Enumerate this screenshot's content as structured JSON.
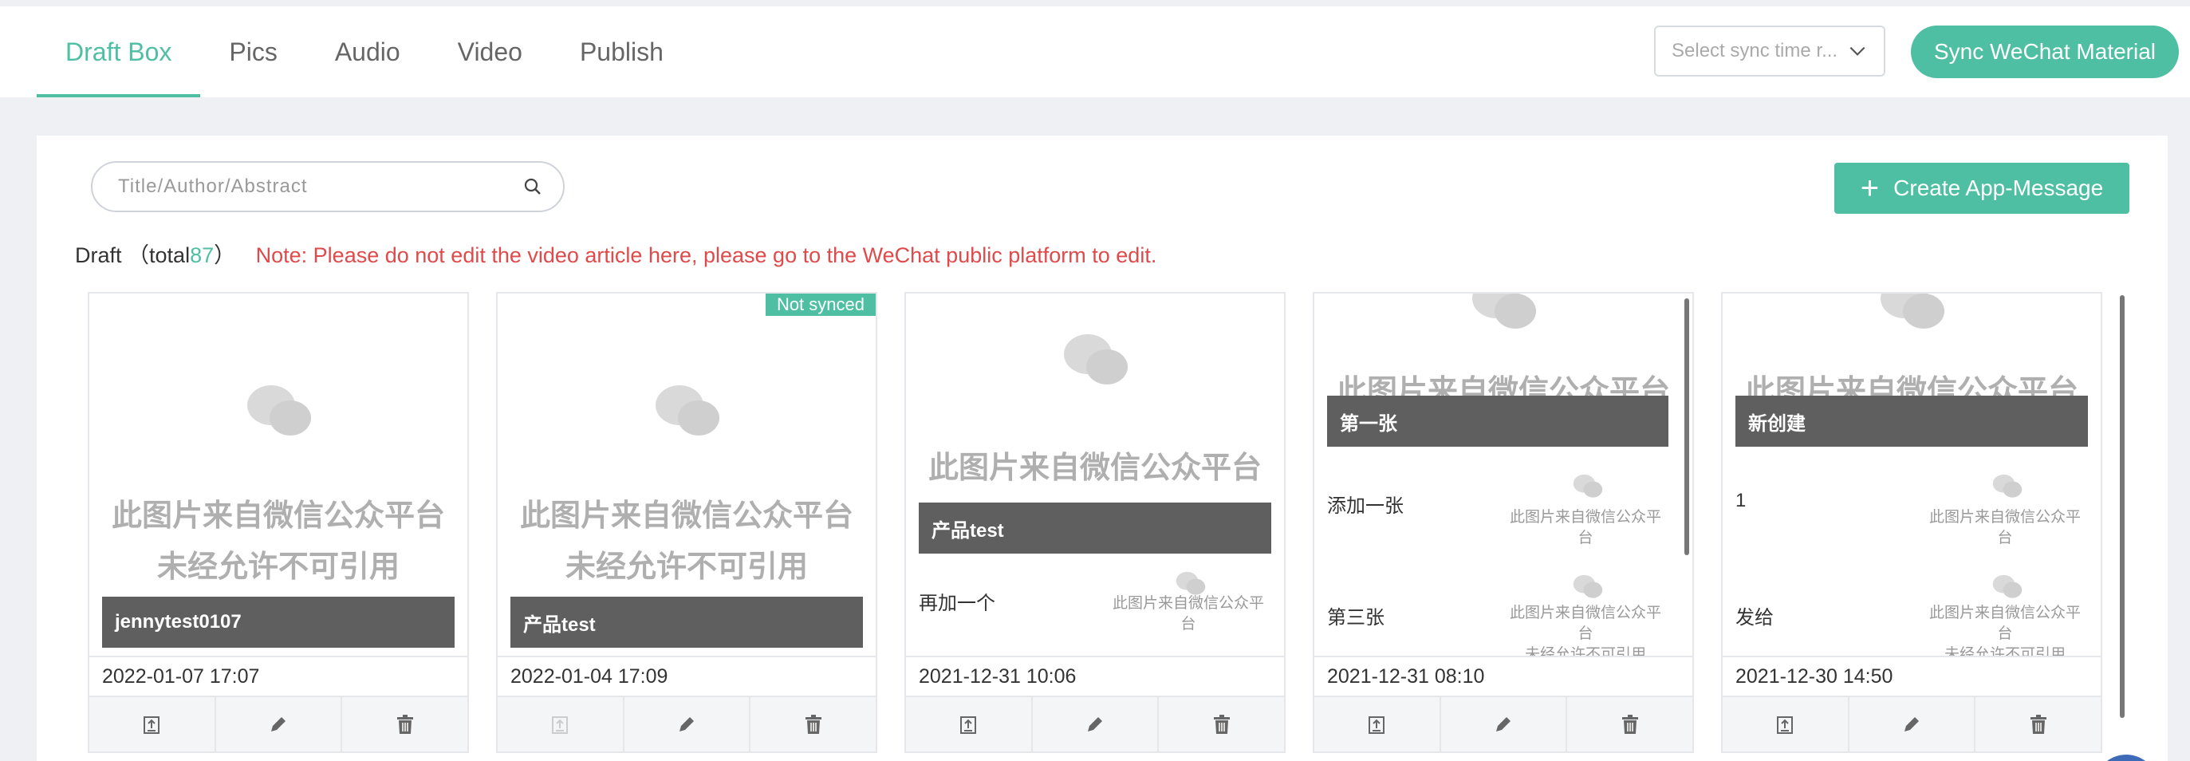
{
  "tabs": [
    {
      "label": "Draft Box",
      "active": true
    },
    {
      "label": "Pics",
      "active": false
    },
    {
      "label": "Audio",
      "active": false
    },
    {
      "label": "Video",
      "active": false
    },
    {
      "label": "Publish",
      "active": false
    }
  ],
  "toolbar": {
    "sync_time_placeholder": "Select sync time r...",
    "sync_button": "Sync WeChat Material"
  },
  "search": {
    "placeholder": "Title/Author/Abstract",
    "value": ""
  },
  "create_button": "Create App-Message",
  "draft": {
    "label": "Draft",
    "total_prefix": "（total",
    "total": "87",
    "total_suffix": "）",
    "note": "Note: Please do not edit the video article here, please go to the WeChat public platform to edit."
  },
  "placeholder_image": {
    "line1": "此图片来自微信公众平台",
    "line2": "未经允许不可引用"
  },
  "cards": [
    {
      "title": "jennytest0107",
      "date": "2022-01-07 17:07",
      "badge": "",
      "sub_items": []
    },
    {
      "title": "产品test",
      "date": "2022-01-04 17:09",
      "badge": "Not synced",
      "sub_items": []
    },
    {
      "title": "产品test",
      "date": "2021-12-31 10:06",
      "badge": "",
      "sub_items": [
        "再加一个"
      ]
    },
    {
      "title": "第一张",
      "date": "2021-12-31 08:10",
      "badge": "",
      "sub_items": [
        "添加一张",
        "第三张"
      ]
    },
    {
      "title": "新创建",
      "date": "2021-12-30 14:50",
      "badge": "",
      "sub_items": [
        "1",
        "发给"
      ]
    }
  ],
  "colors": {
    "accent": "#4fbfa3",
    "note": "#e04a4a",
    "title_bar": "#5f5f5f"
  },
  "icons": [
    "chevron-down-icon",
    "search-icon",
    "plus-icon",
    "wechat-logo-icon",
    "sync-upload-icon",
    "edit-pencil-icon",
    "delete-trash-icon"
  ]
}
